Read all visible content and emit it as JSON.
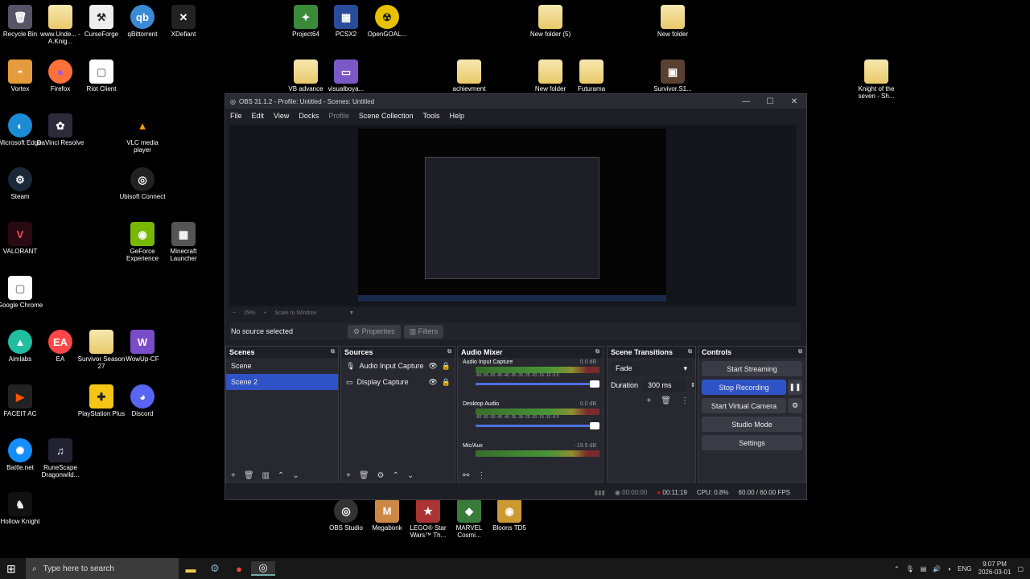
{
  "desktop": {
    "icons": [
      {
        "label": "Recycle Bin",
        "glyph": "🗑"
      },
      {
        "label": "www.Unde... - A.Knig...",
        "glyph": ""
      },
      {
        "label": "CurseForge",
        "glyph": "⚒"
      },
      {
        "label": "qBittorrent",
        "glyph": "qb"
      },
      {
        "label": "XDefiant",
        "glyph": "✕"
      },
      {
        "label": "Project64",
        "glyph": "✦"
      },
      {
        "label": "PCSX2",
        "glyph": "▦"
      },
      {
        "label": "OpenGOAL...",
        "glyph": "☢"
      },
      {
        "label": "New folder (5)",
        "glyph": ""
      },
      {
        "label": "New folder",
        "glyph": ""
      },
      {
        "label": "Vortex",
        "glyph": "◓"
      },
      {
        "label": "Firefox",
        "glyph": "●"
      },
      {
        "label": "Riot Client",
        "glyph": "▢"
      },
      {
        "label": "VB advance",
        "glyph": ""
      },
      {
        "label": "visualboya...",
        "glyph": "▭"
      },
      {
        "label": "achievment",
        "glyph": ""
      },
      {
        "label": "New folder",
        "glyph": ""
      },
      {
        "label": "Futurama",
        "glyph": ""
      },
      {
        "label": "Survivor.S1...",
        "glyph": "▣"
      },
      {
        "label": "Knight of the seven - Sh...",
        "glyph": ""
      },
      {
        "label": "Microsoft Edge",
        "glyph": "◐"
      },
      {
        "label": "DaVinci Resolve",
        "glyph": "✿"
      },
      {
        "label": "VLC media player",
        "glyph": "▲"
      },
      {
        "label": "Steam",
        "glyph": "⚙"
      },
      {
        "label": "Ubisoft Connect",
        "glyph": "◎"
      },
      {
        "label": "VALORANT",
        "glyph": "V"
      },
      {
        "label": "GeForce Experience",
        "glyph": "◉"
      },
      {
        "label": "Minecraft Launcher",
        "glyph": "▦"
      },
      {
        "label": "Google Chrome",
        "glyph": "▢"
      },
      {
        "label": "Aimlabs",
        "glyph": "▲"
      },
      {
        "label": "EA",
        "glyph": "EA"
      },
      {
        "label": "Survivor Season 27",
        "glyph": ""
      },
      {
        "label": "WowUp-CF",
        "glyph": "W"
      },
      {
        "label": "FACEIT AC",
        "glyph": "▶"
      },
      {
        "label": "PlayStation Plus",
        "glyph": "✚"
      },
      {
        "label": "Discord",
        "glyph": "◕"
      },
      {
        "label": "Battle.net",
        "glyph": "✺"
      },
      {
        "label": "RuneScape Dragonwild...",
        "glyph": "♫"
      },
      {
        "label": "Hollow Knight",
        "glyph": "♞"
      },
      {
        "label": "OBS Studio",
        "glyph": "◎"
      },
      {
        "label": "Megabonk",
        "glyph": "M"
      },
      {
        "label": "LEGO® Star Wars™ Th...",
        "glyph": "★"
      },
      {
        "label": "MARVEL Cosmi...",
        "glyph": "◆"
      },
      {
        "label": "Bloons TD5",
        "glyph": "◉"
      }
    ]
  },
  "obs": {
    "title": "OBS 31.1.2 - Profile: Untitled - Scenes: Untitled",
    "menu": [
      "File",
      "Edit",
      "View",
      "Docks",
      "Profile",
      "Scene Collection",
      "Tools",
      "Help"
    ],
    "zoom": "29%",
    "scale": "Scale to Window",
    "no_source": "No source selected",
    "properties": "Properties",
    "filters": "Filters",
    "scenes": {
      "title": "Scenes",
      "items": [
        "Scene",
        "Scene 2"
      ]
    },
    "sources": {
      "title": "Sources",
      "items": [
        "Audio Input Capture",
        "Display Capture"
      ]
    },
    "mixer": {
      "title": "Audio Mixer",
      "channels": [
        {
          "name": "Audio Input Capture",
          "db": "0.0 dB"
        },
        {
          "name": "Desktop Audio",
          "db": "0.0 dB"
        },
        {
          "name": "Mic/Aux",
          "db": "-19.5 dB"
        }
      ],
      "scale": "-60 -55 -50 -45 -40 -35 -30 -25 -20 -15 -10 -5 0"
    },
    "transitions": {
      "title": "Scene Transitions",
      "selected": "Fade",
      "duration_label": "Duration",
      "duration": "300 ms"
    },
    "controls": {
      "title": "Controls",
      "start_streaming": "Start Streaming",
      "stop_recording": "Stop Recording",
      "start_virtual_camera": "Start Virtual Camera",
      "studio_mode": "Studio Mode",
      "settings": "Settings"
    },
    "status": {
      "stream_time": "00:00:00",
      "rec_time": "00:11:19",
      "cpu": "CPU: 0.8%",
      "fps": "60.00 / 60.00 FPS"
    }
  },
  "taskbar": {
    "search_placeholder": "Type here to search",
    "lang": "ENG",
    "time": "9:07 PM",
    "date": "2026-03-01"
  }
}
